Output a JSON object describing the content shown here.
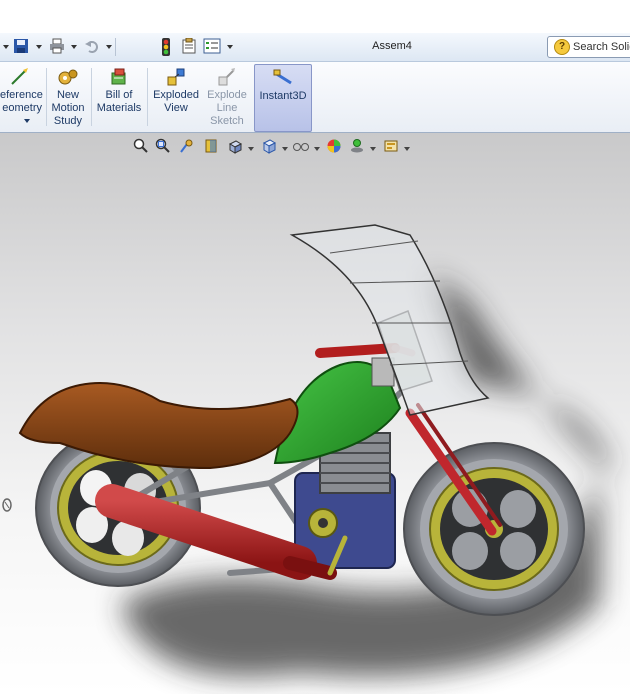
{
  "window": {
    "doc_title": "Assem4"
  },
  "search": {
    "label": "Search Solid"
  },
  "ribbon": {
    "reference_geometry": {
      "line1": "eference",
      "line2": "eometry"
    },
    "new_motion_study": {
      "line1": "New",
      "line2": "Motion",
      "line3": "Study"
    },
    "bill_of_materials": {
      "line1": "Bill of",
      "line2": "Materials"
    },
    "exploded_view": {
      "line1": "Exploded",
      "line2": "View"
    },
    "explode_line_sketch": {
      "line1": "Explode",
      "line2": "Line",
      "line3": "Sketch"
    },
    "instant3d": {
      "line1": "Instant3D"
    }
  },
  "icons": {
    "quick": [
      "dropdown-arrow-icon",
      "save-icon",
      "print-icon",
      "undo-icon",
      "select-arrow-icon",
      "rebuild-traffic-light-icon",
      "file-properties-icon",
      "options-icon"
    ],
    "view": [
      "zoom-to-fit-icon",
      "zoom-area-icon",
      "previous-view-icon",
      "section-view-icon",
      "view-orientation-icon",
      "display-style-icon",
      "hide-show-items-icon",
      "edit-appearance-icon",
      "apply-scene-icon",
      "view-settings-icon"
    ]
  },
  "colors": {
    "ribbon_text": "#1e3a66",
    "active_tab": "#b8c2e8",
    "tank": "#2fa82f",
    "exhaust": "#b21e1e",
    "seat": "#7a3d10",
    "rims": "#b8b43a"
  }
}
